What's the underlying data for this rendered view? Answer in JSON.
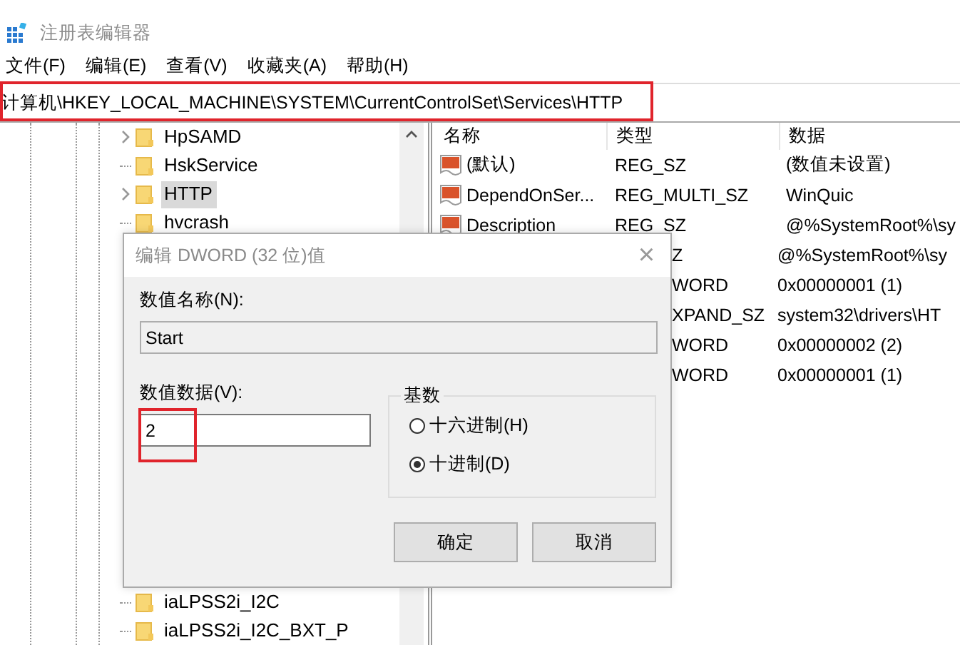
{
  "window": {
    "title": "注册表编辑器"
  },
  "menu": [
    "文件(F)",
    "编辑(E)",
    "查看(V)",
    "收藏夹(A)",
    "帮助(H)"
  ],
  "address": "计算机\\HKEY_LOCAL_MACHINE\\SYSTEM\\CurrentControlSet\\Services\\HTTP",
  "tree": {
    "top_items": [
      {
        "label": "HpSAMD",
        "expandable": true,
        "selected": false
      },
      {
        "label": "HskService",
        "expandable": false,
        "selected": false
      },
      {
        "label": "HTTP",
        "expandable": true,
        "selected": true
      },
      {
        "label": "hvcrash",
        "expandable": false,
        "selected": false
      }
    ],
    "bottom_items": [
      {
        "label": "iaLPSS2i_I2C",
        "expandable": false,
        "selected": false
      },
      {
        "label": "iaLPSS2i_I2C_BXT_P",
        "expandable": false,
        "selected": false
      }
    ]
  },
  "values": {
    "columns": [
      "名称",
      "类型",
      "数据"
    ],
    "rows": [
      {
        "name": "(默认)",
        "type": "REG_SZ",
        "data": "(数值未设置)",
        "covered": false
      },
      {
        "name": "DependOnSer...",
        "type": "REG_MULTI_SZ",
        "data": "WinQuic",
        "covered": false
      },
      {
        "name": "Description",
        "type": "REG_SZ",
        "data": "@%SystemRoot%\\sy",
        "covered": false
      },
      {
        "type": "Z",
        "data": "@%SystemRoot%\\sy",
        "covered": true
      },
      {
        "type": "WORD",
        "data": "0x00000001 (1)",
        "covered": true
      },
      {
        "type": "XPAND_SZ",
        "data": "system32\\drivers\\HT",
        "covered": true
      },
      {
        "type": "WORD",
        "data": "0x00000002 (2)",
        "covered": true
      },
      {
        "type": "WORD",
        "data": "0x00000001 (1)",
        "covered": true
      }
    ]
  },
  "dialog": {
    "title": "编辑 DWORD (32 位)值",
    "close": "×",
    "name_label": "数值名称(N):",
    "name_value": "Start",
    "data_label": "数值数据(V):",
    "data_value": "2",
    "base_label": "基数",
    "bases": [
      {
        "label": "十六进制(H)",
        "selected": false
      },
      {
        "label": "十进制(D)",
        "selected": true
      }
    ],
    "buttons": [
      "确定",
      "取消"
    ]
  }
}
